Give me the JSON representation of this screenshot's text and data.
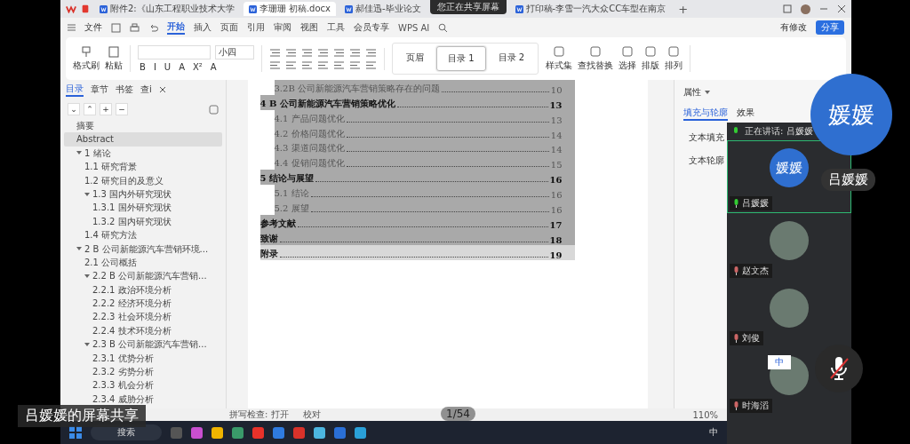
{
  "share_banner": "您正在共享屏幕",
  "tabs": [
    {
      "label": "附件2:《山东工程职业技术大学",
      "selected": false
    },
    {
      "label": "李珊珊 初稿.docx",
      "selected": true
    },
    {
      "label": "郝佳迅-毕业论文",
      "selected": false
    },
    {
      "label": "打印稿-李雪一汽大众CC车型在南京",
      "selected": false
    }
  ],
  "new_tab": "+",
  "menu": {
    "file": "文件",
    "items": [
      {
        "label": "开始",
        "selected": true
      },
      {
        "label": "插入",
        "selected": false
      },
      {
        "label": "页面",
        "selected": false
      },
      {
        "label": "引用",
        "selected": false
      },
      {
        "label": "审阅",
        "selected": false
      },
      {
        "label": "视图",
        "selected": false
      },
      {
        "label": "工具",
        "selected": false
      },
      {
        "label": "会员专享",
        "selected": false
      }
    ],
    "ai": "WPS AI",
    "modified": "有修改",
    "share": "分享"
  },
  "ribbon": {
    "format_painter": "格式刷",
    "paste": "粘贴",
    "font_size": "小四",
    "format_buttons": [
      "B",
      "I",
      "U",
      "A",
      "X²",
      "A"
    ],
    "styles": [
      {
        "label": "页眉",
        "selected": false
      },
      {
        "label": "目录 1",
        "selected": true
      },
      {
        "label": "目录 2",
        "selected": false
      }
    ],
    "tools": [
      "样式集",
      "查找替换",
      "选择",
      "排版",
      "排列"
    ]
  },
  "nav": {
    "tabs": [
      {
        "label": "目录",
        "selected": true
      },
      {
        "label": "章节",
        "selected": false
      },
      {
        "label": "书签",
        "selected": false
      },
      {
        "label": "查i",
        "selected": false
      }
    ],
    "controls": [
      "⌄",
      "⌃",
      "+",
      "−"
    ],
    "items": [
      {
        "label": "摘要",
        "selected": false
      },
      {
        "label": "Abstract",
        "selected": true
      },
      {
        "label": "1 绪论",
        "selected": false,
        "expanded": true,
        "children": [
          {
            "label": "1.1 研究背景",
            "selected": false
          },
          {
            "label": "1.2 研究目的及意义",
            "selected": false
          },
          {
            "label": "1.3 国内外研究现状",
            "selected": false,
            "expanded": true,
            "children": [
              {
                "label": "1.3.1 国外研究现状",
                "selected": false
              },
              {
                "label": "1.3.2 国内研究现状",
                "selected": false
              }
            ]
          },
          {
            "label": "1.4 研究方法",
            "selected": false
          }
        ]
      },
      {
        "label": "2 B 公司新能源汽车营销环境...",
        "selected": false,
        "expanded": true,
        "children": [
          {
            "label": "2.1 公司概括",
            "selected": false
          },
          {
            "label": "2.2 B 公司新能源汽车营销...",
            "selected": false,
            "expanded": true,
            "children": [
              {
                "label": "2.2.1 政治环境分析",
                "selected": false
              },
              {
                "label": "2.2.2 经济环境分析",
                "selected": false
              },
              {
                "label": "2.2.3 社会环境分析",
                "selected": false
              },
              {
                "label": "2.2.4 技术环境分析",
                "selected": false
              }
            ]
          },
          {
            "label": "2.3 B 公司新能源汽车营销...",
            "selected": false,
            "expanded": true,
            "children": [
              {
                "label": "2.3.1 优势分析",
                "selected": false
              },
              {
                "label": "2.3.2 劣势分析",
                "selected": false
              },
              {
                "label": "2.3.3 机会分析",
                "selected": false
              },
              {
                "label": "2.3.4 威胁分析",
                "selected": false
              }
            ]
          }
        ]
      }
    ]
  },
  "toc": [
    {
      "kind": "section",
      "text": "3.2B 公司新能源汽车营销策略存在的问题",
      "page": "10",
      "selected": true
    },
    {
      "kind": "chapter",
      "text": "4 B 公司新能源汽车营销策略优化",
      "page": "13",
      "selected": true
    },
    {
      "kind": "section",
      "text": "4.1 产品问题优化",
      "page": "13",
      "selected": true
    },
    {
      "kind": "section",
      "text": "4.2 价格问题优化",
      "page": "14",
      "selected": true
    },
    {
      "kind": "section",
      "text": "4.3 渠道问题优化",
      "page": "14",
      "selected": true
    },
    {
      "kind": "section",
      "text": "4.4 促销问题优化",
      "page": "15",
      "selected": true
    },
    {
      "kind": "chapter",
      "text": "5 结论与展望",
      "page": "16",
      "selected": true
    },
    {
      "kind": "section",
      "text": "5.1 结论",
      "page": "16",
      "selected": true
    },
    {
      "kind": "section",
      "text": "5.2 展望",
      "page": "16",
      "selected": true
    },
    {
      "kind": "chapter",
      "text": "参考文献",
      "page": "17",
      "selected": true
    },
    {
      "kind": "chapter",
      "text": "致谢",
      "page": "18",
      "selected": true
    },
    {
      "kind": "chapter",
      "text": "附录",
      "page": "19",
      "selected": false
    }
  ],
  "properties": {
    "title": "属性",
    "tabs": [
      {
        "label": "填充与轮廓",
        "selected": true
      },
      {
        "label": "效果",
        "selected": false
      }
    ],
    "sections": [
      "文本填充",
      "文本轮廓"
    ]
  },
  "status_bar": {
    "spell_check": "拼写检查: 打开",
    "proofread": "校对",
    "page_counter": "1/54",
    "zoom": "110%"
  },
  "taskbar": {
    "search": "搜索",
    "ime": "中"
  },
  "meeting": {
    "speaking": "正在讲话: 吕媛媛",
    "participants": [
      {
        "name": "吕媛媛",
        "avatar_text": "媛媛",
        "speaking": true
      },
      {
        "name": "赵文杰",
        "speaking": false
      },
      {
        "name": "刘俊",
        "speaking": false
      },
      {
        "name": "时海滔",
        "speaking": false
      }
    ],
    "presenter": {
      "avatar_text": "媛媛",
      "name": "吕媛媛"
    },
    "caption": "吕媛媛的屏幕共享",
    "ime_bar": "中"
  }
}
